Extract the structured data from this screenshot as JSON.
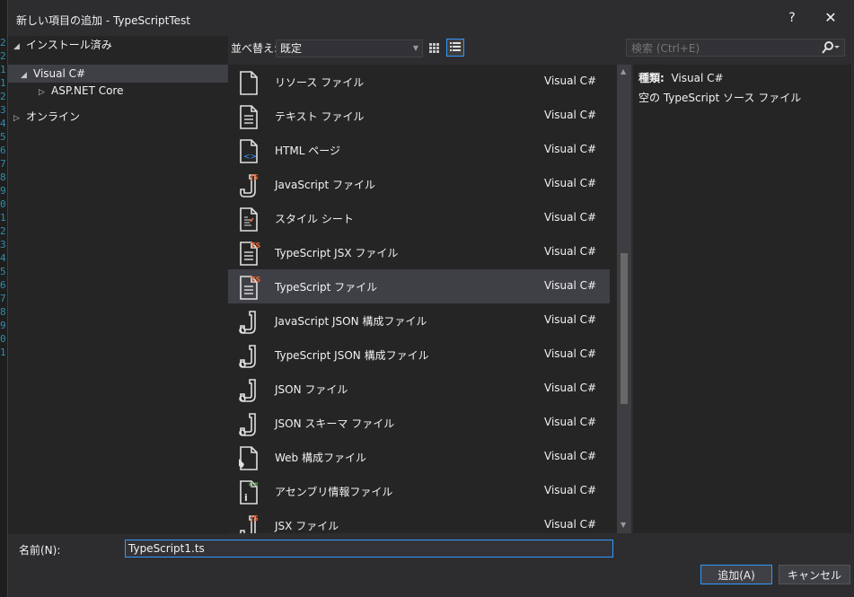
{
  "background": {
    "line_numbers": [
      "2",
      "2",
      "1",
      "1",
      "2",
      "3",
      "4",
      "5",
      "6",
      "7",
      "8",
      "9",
      "0",
      "1",
      "2",
      "3",
      "4",
      "5",
      "6",
      "7",
      "8",
      "9",
      "0",
      "1",
      "2"
    ]
  },
  "dialog": {
    "title": "新しい項目の追加 - TypeScriptTest",
    "help_label": "?",
    "close_label": "✕"
  },
  "tree": {
    "installed": "インストール済み",
    "visual_cs": "Visual C#",
    "aspnet": "ASP.NET Core",
    "online": "オンライン"
  },
  "toolbar": {
    "sort_label": "並べ替え:",
    "sort_value": "既定"
  },
  "search": {
    "placeholder": "検索 (Ctrl+E)"
  },
  "items": [
    {
      "name": "リソース ファイル",
      "lang": "Visual C#",
      "icon": "resource-file-icon"
    },
    {
      "name": "テキスト ファイル",
      "lang": "Visual C#",
      "icon": "text-file-icon"
    },
    {
      "name": "HTML ページ",
      "lang": "Visual C#",
      "icon": "html-page-icon"
    },
    {
      "name": "JavaScript ファイル",
      "lang": "Visual C#",
      "icon": "javascript-file-icon"
    },
    {
      "name": "スタイル シート",
      "lang": "Visual C#",
      "icon": "stylesheet-icon"
    },
    {
      "name": "TypeScript JSX ファイル",
      "lang": "Visual C#",
      "icon": "typescript-jsx-file-icon"
    },
    {
      "name": "TypeScript ファイル",
      "lang": "Visual C#",
      "icon": "typescript-file-icon",
      "selected": true
    },
    {
      "name": "JavaScript JSON 構成ファイル",
      "lang": "Visual C#",
      "icon": "json-config-icon"
    },
    {
      "name": "TypeScript JSON 構成ファイル",
      "lang": "Visual C#",
      "icon": "json-config-icon"
    },
    {
      "name": "JSON ファイル",
      "lang": "Visual C#",
      "icon": "json-file-icon"
    },
    {
      "name": "JSON スキーマ ファイル",
      "lang": "Visual C#",
      "icon": "json-schema-icon"
    },
    {
      "name": "Web 構成ファイル",
      "lang": "Visual C#",
      "icon": "web-config-icon"
    },
    {
      "name": "アセンブリ情報ファイル",
      "lang": "Visual C#",
      "icon": "assembly-info-icon"
    },
    {
      "name": "JSX ファイル",
      "lang": "Visual C#",
      "icon": "jsx-file-icon"
    }
  ],
  "details": {
    "type_label": "種類:",
    "type_value": "Visual C#",
    "description": "空の TypeScript ソース ファイル"
  },
  "bottom": {
    "name_label": "名前(N):",
    "name_value": "TypeScript1.ts",
    "add_button": "追加(A)",
    "cancel_button": "キャンセル"
  },
  "colors": {
    "accent": "#3399ff",
    "ts_badge": "#e8632b",
    "js_badge": "#e8632b"
  }
}
